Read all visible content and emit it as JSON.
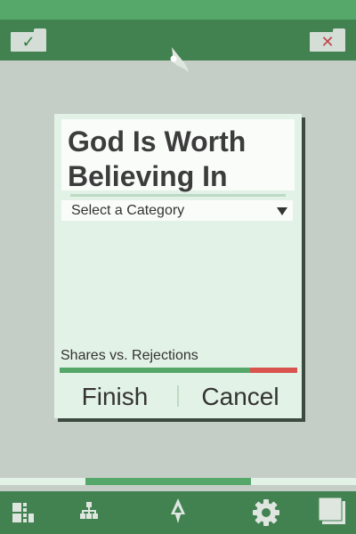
{
  "top_bar": {
    "accept_icon": "check-folder-icon",
    "logo_icon": "shark-fin-logo-icon",
    "reject_icon": "x-folder-icon"
  },
  "card": {
    "title": "God Is Worth Believing In",
    "category_select": {
      "selected": "Select a Category"
    },
    "ratio": {
      "label": "Shares vs. Rejections",
      "shares_fraction": 0.8
    },
    "finish_label": "Finish",
    "cancel_label": "Cancel"
  },
  "progress": {
    "start_fraction": 0.24,
    "end_fraction": 0.705
  },
  "bottom_nav": {
    "items": [
      "tiles-icon",
      "hierarchy-icon",
      "home-fin-icon",
      "gear-icon",
      "layers-icon"
    ]
  },
  "colors": {
    "accent": "#55a869",
    "bar": "#428250",
    "reject": "#d9534f",
    "background": "#c5cdc7",
    "card": "#e3f2e6"
  }
}
